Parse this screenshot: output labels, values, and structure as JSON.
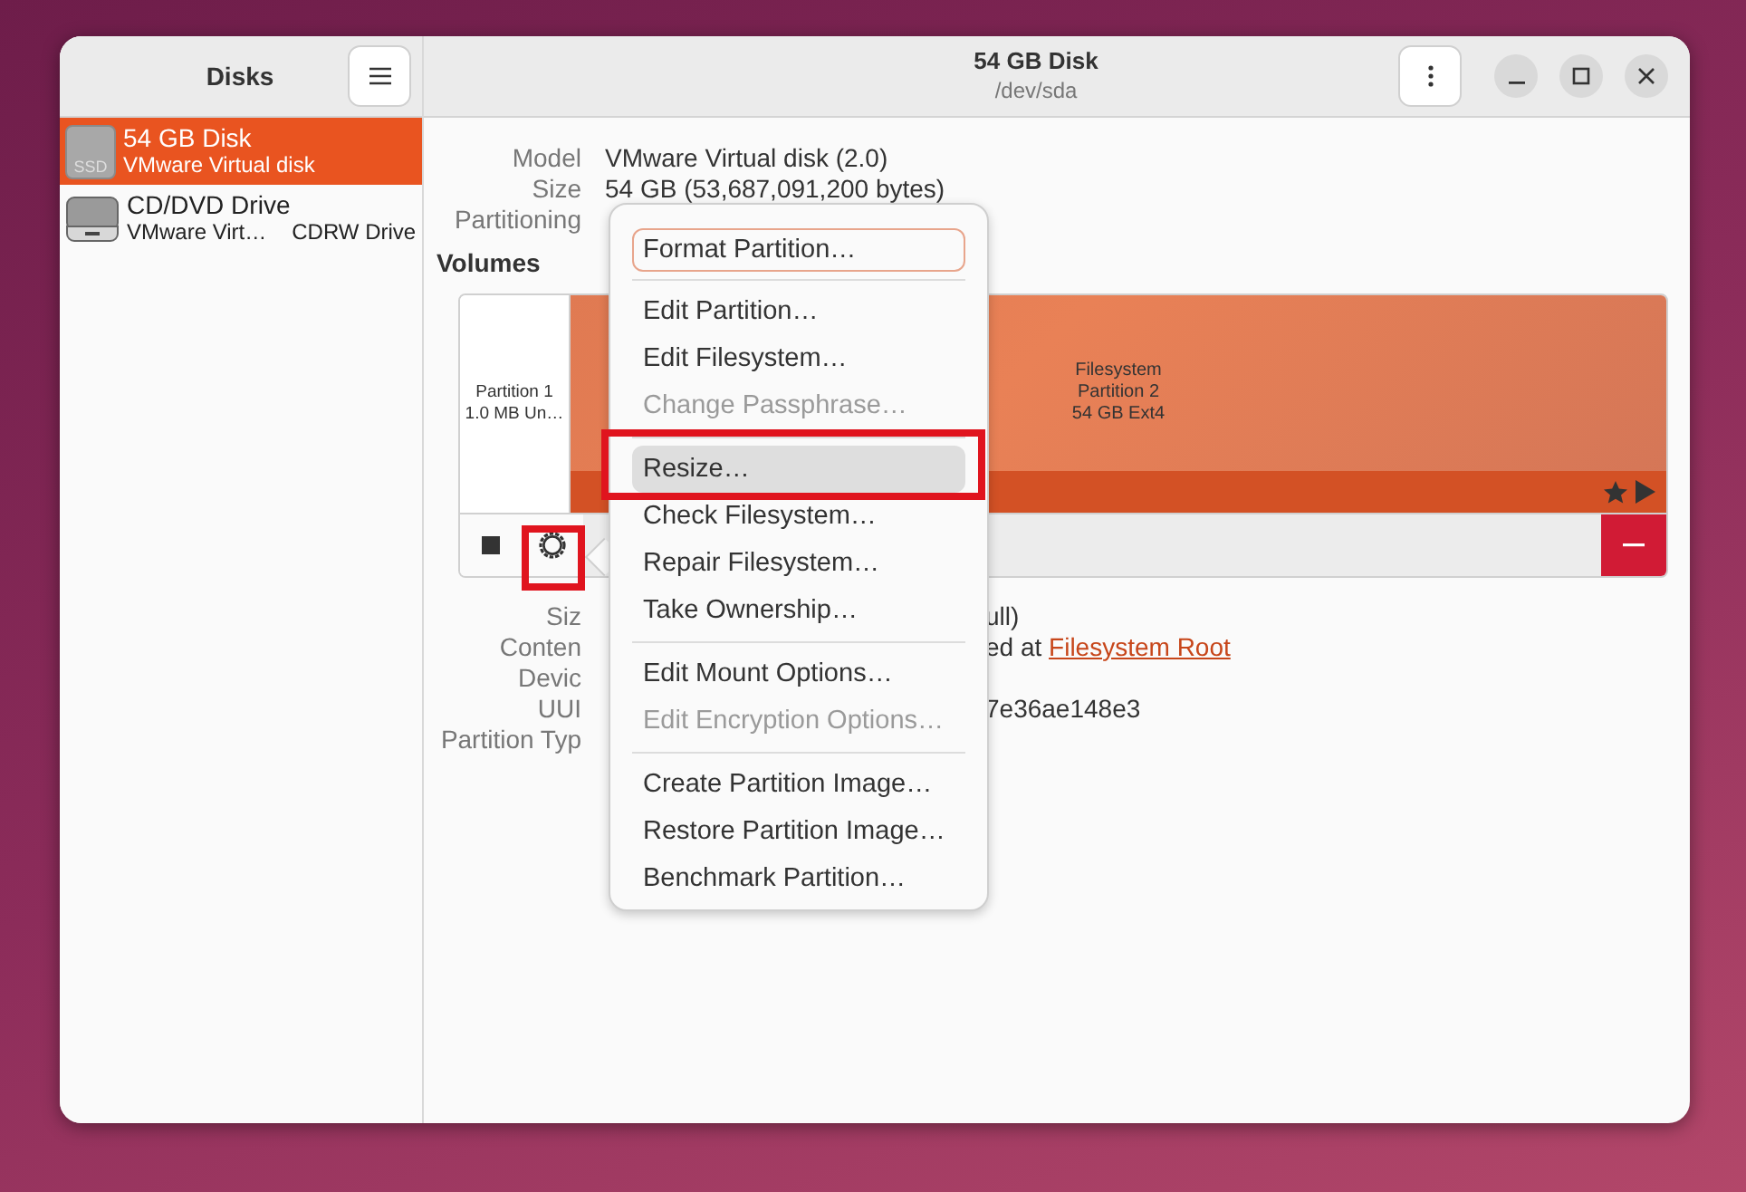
{
  "sidebar": {
    "title": "Disks",
    "items": [
      {
        "name": "54 GB Disk",
        "subtitle": "VMware Virtual disk",
        "icon_label": "SSD",
        "kind": "ssd",
        "selected": true
      },
      {
        "name": "CD/DVD Drive",
        "subtitle": "VMware Virt…",
        "extra": "CDRW Drive",
        "kind": "optical",
        "selected": false
      }
    ]
  },
  "header": {
    "title": "54 GB Disk",
    "subtitle": "/dev/sda"
  },
  "details": [
    {
      "label": "Model",
      "value": "VMware Virtual disk (2.0)"
    },
    {
      "label": "Size",
      "value": "54 GB (53,687,091,200 bytes)"
    },
    {
      "label": "Partitioning"
    }
  ],
  "volumes": {
    "title": "Volumes",
    "partitions": [
      {
        "kind": "small",
        "lines": [
          "Partition 1",
          "1.0 MB Un…"
        ]
      },
      {
        "kind": "filesystem",
        "lines": [
          "Filesystem",
          "Partition 2",
          "54 GB Ext4"
        ]
      }
    ]
  },
  "volume_details": [
    {
      "label": "Siz",
      "value": "ull)"
    },
    {
      "label": "Conten",
      "value": "ed at ",
      "link": "Filesystem Root"
    },
    {
      "label": "Devic"
    },
    {
      "label": "UUI",
      "value": "7e36ae148e3"
    },
    {
      "label": "Partition Typ"
    }
  ],
  "menu": {
    "groups": [
      [
        {
          "label": "Format Partition…",
          "disabled": false,
          "focused": true,
          "hovered": false
        }
      ],
      [
        {
          "label": "Edit Partition…",
          "disabled": false,
          "focused": false,
          "hovered": false
        },
        {
          "label": "Edit Filesystem…",
          "disabled": false,
          "focused": false,
          "hovered": false
        },
        {
          "label": "Change Passphrase…",
          "disabled": true,
          "focused": false,
          "hovered": false
        }
      ],
      [
        {
          "label": "Resize…",
          "disabled": false,
          "focused": false,
          "hovered": true
        },
        {
          "label": "Check Filesystem…",
          "disabled": false,
          "focused": false,
          "hovered": false
        },
        {
          "label": "Repair Filesystem…",
          "disabled": false,
          "focused": false,
          "hovered": false
        },
        {
          "label": "Take Ownership…",
          "disabled": false,
          "focused": false,
          "hovered": false
        }
      ],
      [
        {
          "label": "Edit Mount Options…",
          "disabled": false,
          "focused": false,
          "hovered": false
        },
        {
          "label": "Edit Encryption Options…",
          "disabled": true,
          "focused": false,
          "hovered": false
        }
      ],
      [
        {
          "label": "Create Partition Image…",
          "disabled": false,
          "focused": false,
          "hovered": false
        },
        {
          "label": "Restore Partition Image…",
          "disabled": false,
          "focused": false,
          "hovered": false
        },
        {
          "label": "Benchmark Partition…",
          "disabled": false,
          "focused": false,
          "hovered": false
        }
      ]
    ]
  }
}
